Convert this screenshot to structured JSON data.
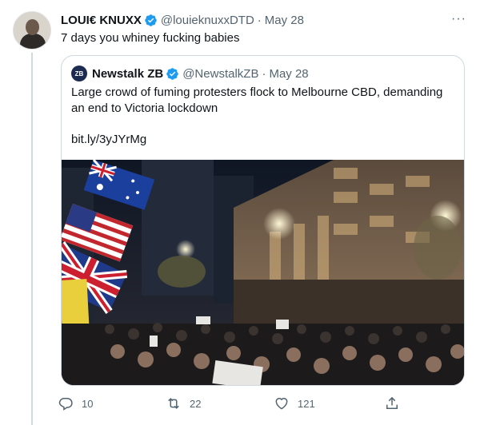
{
  "tweet": {
    "author_name": "LOUI€ KNUXX",
    "author_handle": "@louieknuxxDTD",
    "separator": "·",
    "date": "May 28",
    "text": "7 days you whiney fucking babies",
    "more_icon": "more-horizontal-icon",
    "verified": true
  },
  "quote": {
    "logo_text": "ZB",
    "author_name": "Newstalk ZB",
    "author_handle": "@NewstalkZB",
    "separator": "·",
    "date": "May 28",
    "text": "Large crowd of fuming protesters flock to Melbourne CBD, demanding an end to Victoria lockdown",
    "link": "bit.ly/3yJYrMg",
    "verified": true,
    "image_description_icon": "photo-protest-crowd"
  },
  "actions": {
    "reply_count": "10",
    "retweet_count": "22",
    "like_count": "121",
    "reply_icon": "reply-icon",
    "retweet_icon": "retweet-icon",
    "like_icon": "heart-icon",
    "share_icon": "share-icon"
  },
  "colors": {
    "verified_blue": "#1d9bf0",
    "secondary_text": "#536471",
    "border": "#cfd9de"
  }
}
